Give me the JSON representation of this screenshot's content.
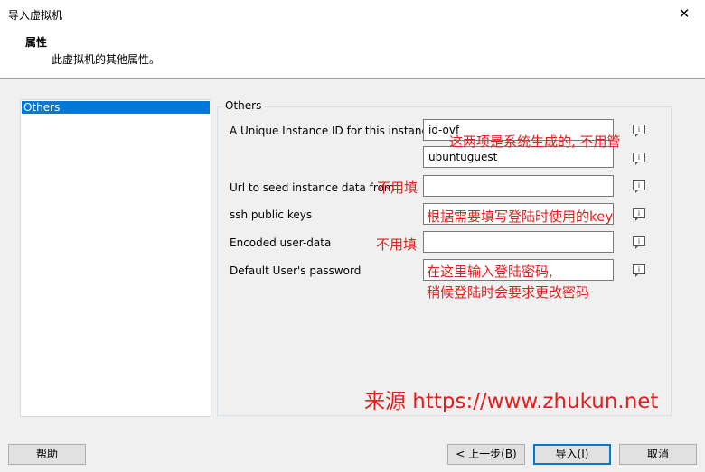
{
  "window": {
    "title": "导入虚拟机",
    "close_glyph": "✕"
  },
  "header": {
    "title": "属性",
    "subtitle": "此虚拟机的其他属性。"
  },
  "sidebar": {
    "items": [
      {
        "label": "Others",
        "selected": true
      }
    ]
  },
  "group": {
    "title": "Others"
  },
  "properties": {
    "instance_id": {
      "label": "A Unique Instance ID for this instance",
      "value": "id-ovf"
    },
    "hostname": {
      "value": "ubuntuguest"
    },
    "seed_url": {
      "label": "Url to seed instance data from",
      "value": ""
    },
    "ssh_keys": {
      "label": "ssh public keys",
      "value": ""
    },
    "user_data": {
      "label": "Encoded user-data",
      "value": ""
    },
    "password": {
      "label": "Default User's password",
      "value": ""
    }
  },
  "annotations": {
    "system_generated": "这两项是系统生成的, 不用管",
    "no_fill_1": "不用填",
    "ssh_hint": "根据需要填写登陆时使用的key",
    "no_fill_2": "不用填",
    "password_line1": "在这里输入登陆密码,",
    "password_line2": "稍候登陆时会要求更改密码",
    "source": "来源 https://www.zhukun.net"
  },
  "info_glyph": "i",
  "buttons": {
    "help": "帮助",
    "back": "< 上一步(B)",
    "import": "导入(I)",
    "cancel": "取消"
  },
  "colors": {
    "selection": "#0078d7",
    "annotation": "#e02020"
  }
}
